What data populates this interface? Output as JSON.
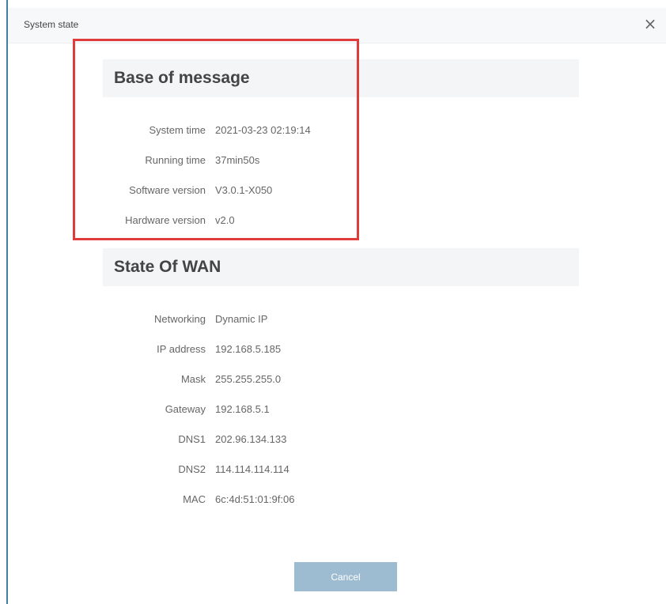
{
  "window": {
    "title": "System state",
    "close_icon": "×"
  },
  "base": {
    "title": "Base of message",
    "rows": [
      {
        "label": "System time",
        "value": "2021-03-23 02:19:14"
      },
      {
        "label": "Running time",
        "value": "37min50s"
      },
      {
        "label": "Software version",
        "value": "V3.0.1-X050"
      },
      {
        "label": "Hardware version",
        "value": "v2.0"
      }
    ]
  },
  "wan": {
    "title": "State Of WAN",
    "rows": [
      {
        "label": "Networking",
        "value": "Dynamic IP"
      },
      {
        "label": "IP address",
        "value": "192.168.5.185"
      },
      {
        "label": "Mask",
        "value": "255.255.255.0"
      },
      {
        "label": "Gateway",
        "value": "192.168.5.1"
      },
      {
        "label": "DNS1",
        "value": "202.96.134.133"
      },
      {
        "label": "DNS2",
        "value": "114.114.114.114"
      },
      {
        "label": "MAC",
        "value": "6c:4d:51:01:9f:06"
      }
    ]
  },
  "footer": {
    "cancel_label": "Cancel"
  },
  "colors": {
    "accent": "#9dbcd1",
    "highlight": "#e03c3c",
    "header_bg": "#f3f5f7"
  }
}
